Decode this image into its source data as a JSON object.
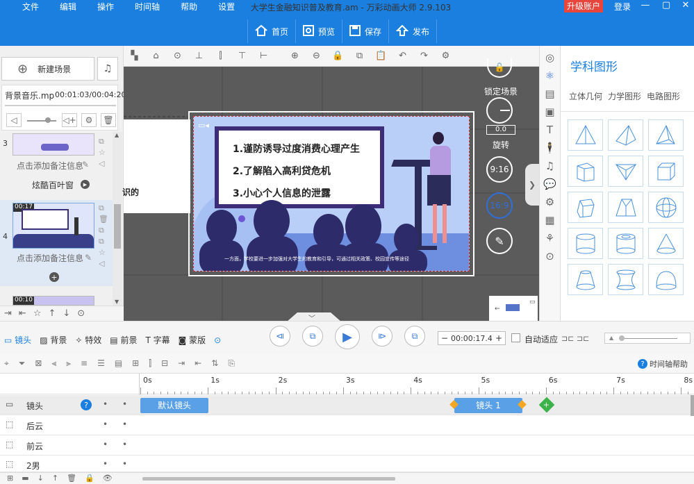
{
  "app": {
    "title": "大学生金融知识普及教育.am - 万彩动画大师 2.9.103",
    "upgrade": "升级账户",
    "login": "登录"
  },
  "menu": [
    "文件",
    "编辑",
    "操作",
    "时间轴",
    "帮助",
    "设置"
  ],
  "main_toolbar": [
    {
      "label": "首页",
      "icon": "home-icon"
    },
    {
      "label": "预览",
      "icon": "preview-icon"
    },
    {
      "label": "保存",
      "icon": "save-icon"
    },
    {
      "label": "发布",
      "icon": "publish-icon"
    }
  ],
  "left": {
    "new_scene": "新建场景",
    "bgm": {
      "name": "背景音乐.mp",
      "time": "00:01:03/00:04:20"
    },
    "scenes": [
      {
        "num": "3",
        "note": "点击添加备注信息",
        "transition": "炫酷百叶窗"
      },
      {
        "num": "4",
        "time": "00:17",
        "note": "点击添加备注信息"
      },
      {
        "time": "00:10"
      }
    ]
  },
  "canvas": {
    "edge_text": "识的",
    "slide": {
      "lines": [
        "1.谨防诱导过度消费心理产生",
        "2.了解陷入高利贷危机",
        "3.小心个人信息的泄露"
      ],
      "caption": "一方面，学校要进一步加强对大学生的教育和引导，可通过相关政策、校园宣传等途径"
    },
    "controls": {
      "lock": "锁定场景",
      "rotate": "旋转",
      "rotate_value": "0.0",
      "ratio1": "9:16",
      "ratio2": "16:9"
    }
  },
  "right": {
    "title": "学科图形",
    "tabs": [
      "立体几何",
      "力学图形",
      "电路图形"
    ]
  },
  "playbar": {
    "tabs": [
      "镜头",
      "背景",
      "特效",
      "前景",
      "字幕",
      "蒙版"
    ],
    "time": "00:00:17.4",
    "autofit": "自动适应"
  },
  "timeline": {
    "help": "时间轴帮助",
    "ticks": [
      "0s",
      "1s",
      "2s",
      "3s",
      "4s",
      "5s",
      "6s",
      "7s",
      "8s"
    ],
    "tracks": [
      "镜头",
      "后云",
      "前云",
      "2男"
    ],
    "clips": [
      {
        "label": "默认镜头"
      },
      {
        "label": "镜头 1"
      }
    ]
  },
  "colors": {
    "brand": "#1b7fe0",
    "clip": "#5aa0e6",
    "upgrade": "#e8453c"
  }
}
